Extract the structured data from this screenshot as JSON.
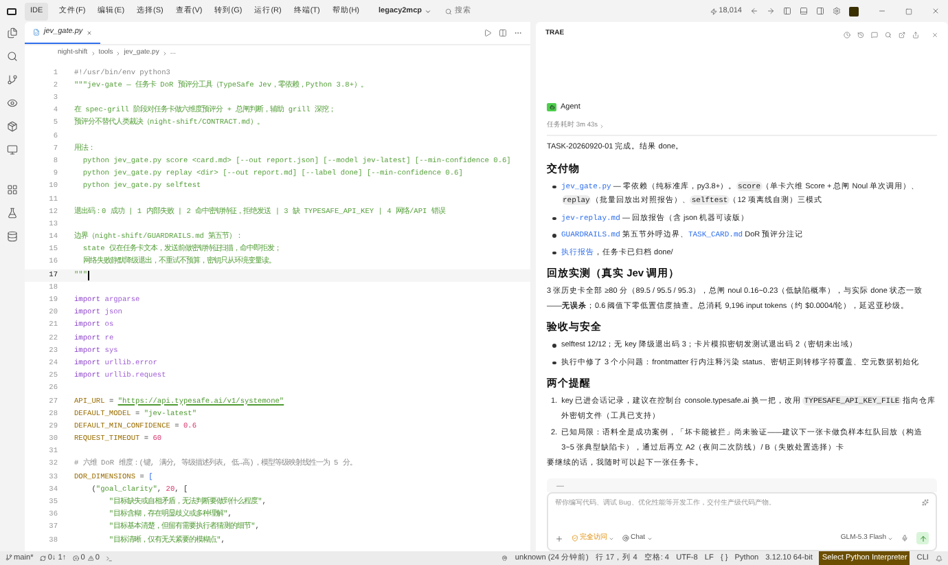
{
  "menubar": {
    "app_tab": "IDE",
    "menus": [
      "文件(F)",
      "编辑(E)",
      "选择(S)",
      "查看(V)",
      "转到(G)",
      "运行(R)",
      "终端(T)",
      "帮助(H)"
    ],
    "project": "legacy2mcp",
    "search_placeholder": "搜索",
    "counter": "18,014"
  },
  "editor": {
    "tab": {
      "label": "jev_gate.py",
      "selected": true
    },
    "breadcrumb": [
      "night-shift",
      "tools",
      "jev_gate.py",
      "..."
    ],
    "lines": [
      {
        "number": "1",
        "current": false,
        "tokens": [
          {
            "kind": "comment",
            "text": "#!/usr/bin/env python3"
          }
        ]
      },
      {
        "number": "2",
        "current": false,
        "tokens": [
          {
            "kind": "doc",
            "text": "\"\"\"jev-gate — 任务卡 DoR 预评分工具（TypeSafe Jev，零依赖，Python 3.8+）。"
          }
        ]
      },
      {
        "number": "3",
        "current": false
      },
      {
        "number": "4",
        "current": false,
        "tokens": [
          {
            "kind": "doc",
            "text": "在 spec-grill 阶段对任务卡做六维度预评分 + 总闸判断，辅助 grill 深挖；"
          }
        ]
      },
      {
        "number": "5",
        "current": false,
        "tokens": [
          {
            "kind": "doc",
            "text": "预评分不替代人类裁决（night-shift/CONTRACT.md）。"
          }
        ]
      },
      {
        "number": "6",
        "current": false
      },
      {
        "number": "7",
        "current": false,
        "tokens": [
          {
            "kind": "doc",
            "text": "用法："
          }
        ]
      },
      {
        "number": "8",
        "current": false,
        "tokens": [
          {
            "kind": "doc",
            "text": "  python jev_gate.py score <card.md> [--out report.json] [--model jev-latest] [--min-confidence 0.6]"
          }
        ]
      },
      {
        "number": "9",
        "current": false,
        "tokens": [
          {
            "kind": "doc",
            "text": "  python jev_gate.py replay <dir> [--out report.md] [--label done] [--min-confidence 0.6]"
          }
        ]
      },
      {
        "number": "10",
        "current": false,
        "tokens": [
          {
            "kind": "doc",
            "text": "  python jev_gate.py selftest"
          }
        ]
      },
      {
        "number": "11",
        "current": false
      },
      {
        "number": "12",
        "current": false,
        "tokens": [
          {
            "kind": "doc",
            "text": "退出码：0 成功 | 1 内部失败 | 2 命中密钥特征，拒绝发送 | 3 缺 TYPESAFE_API_KEY | 4 网络/API 错误"
          }
        ]
      },
      {
        "number": "13",
        "current": false
      },
      {
        "number": "14",
        "current": false,
        "tokens": [
          {
            "kind": "doc",
            "text": "边界（night-shift/GUARDRAILS.md 第五节）："
          }
        ]
      },
      {
        "number": "15",
        "current": false,
        "tokens": [
          {
            "kind": "doc",
            "text": "  state 仅在任务卡文本，发送前做密钥特征扫描，命中即拒发；"
          }
        ]
      },
      {
        "number": "16",
        "current": false,
        "tokens": [
          {
            "kind": "doc",
            "text": "  网络失败静默降级退出，不重试不预算，密钥只从环境变量读。"
          }
        ]
      },
      {
        "number": "17",
        "current": true,
        "tokens": [
          {
            "kind": "doc",
            "text": "\"\"\""
          }
        ]
      },
      {
        "number": "18",
        "current": false
      },
      {
        "number": "19",
        "current": false,
        "tokens": [
          {
            "kind": "keyword",
            "text": "import"
          },
          {
            "kind": "module",
            "text": "argparse"
          }
        ]
      },
      {
        "number": "20",
        "current": false,
        "tokens": [
          {
            "kind": "keyword",
            "text": "import"
          },
          {
            "kind": "module",
            "text": "json"
          }
        ]
      },
      {
        "number": "21",
        "current": false,
        "tokens": [
          {
            "kind": "keyword",
            "text": "import"
          },
          {
            "kind": "module",
            "text": "os"
          }
        ]
      },
      {
        "number": "22",
        "current": false,
        "tokens": [
          {
            "kind": "keyword",
            "text": "import"
          },
          {
            "kind": "module",
            "text": "re"
          }
        ]
      },
      {
        "number": "23",
        "current": false,
        "tokens": [
          {
            "kind": "keyword",
            "text": "import"
          },
          {
            "kind": "module",
            "text": "sys"
          }
        ]
      },
      {
        "number": "24",
        "current": false,
        "tokens": [
          {
            "kind": "keyword",
            "text": "import"
          },
          {
            "kind": "module",
            "text": "urllib.error"
          }
        ]
      },
      {
        "number": "25",
        "current": false,
        "tokens": [
          {
            "kind": "keyword",
            "text": "import"
          },
          {
            "kind": "module",
            "text": "urllib.request"
          }
        ]
      },
      {
        "number": "26",
        "current": false
      },
      {
        "number": "27",
        "current": false,
        "tokens": [
          {
            "kind": "const",
            "text": "API_URL"
          },
          {
            "kind": "plain",
            "text": " = "
          },
          {
            "kind": "url",
            "text": "\"https://api.typesafe.ai/v1/systemone\""
          }
        ]
      },
      {
        "number": "28",
        "current": false,
        "tokens": [
          {
            "kind": "const",
            "text": "DEFAULT_MODEL"
          },
          {
            "kind": "plain",
            "text": " = "
          },
          {
            "kind": "string",
            "text": "\"jev-latest\""
          }
        ]
      },
      {
        "number": "29",
        "current": false,
        "tokens": [
          {
            "kind": "const",
            "text": "DEFAULT_MIN_CONFIDENCE"
          },
          {
            "kind": "plain",
            "text": " = "
          },
          {
            "kind": "number",
            "text": "0.6"
          }
        ]
      },
      {
        "number": "30",
        "current": false,
        "tokens": [
          {
            "kind": "const",
            "text": "REQUEST_TIMEOUT"
          },
          {
            "kind": "plain",
            "text": " = "
          },
          {
            "kind": "number",
            "text": "60"
          }
        ]
      },
      {
        "number": "31",
        "current": false
      },
      {
        "number": "32",
        "current": false,
        "tokens": [
          {
            "kind": "comment",
            "text": "# 六维 DoR 维度：(键, 满分, 等级描述列表, 低→高)，模型等级映射线性一为 5 分。"
          }
        ]
      },
      {
        "number": "33",
        "current": false,
        "tokens": [
          {
            "kind": "const",
            "text": "DOR_DIMENSIONS"
          },
          {
            "kind": "plain",
            "text": " = "
          },
          {
            "kind": "bracket",
            "text": "["
          }
        ]
      },
      {
        "number": "34",
        "current": false,
        "tokens": [
          {
            "kind": "plain",
            "text": "    ("
          },
          {
            "kind": "string",
            "text": "\"goal_clarity\""
          },
          {
            "kind": "plain",
            "text": ", "
          },
          {
            "kind": "number",
            "text": "20"
          },
          {
            "kind": "plain",
            "text": ", ["
          }
        ]
      },
      {
        "number": "35",
        "current": false,
        "tokens": [
          {
            "kind": "string",
            "text": "        \"目标缺失或自相矛盾，无法判断要做到什么程度\""
          },
          {
            "kind": "plain",
            "text": ","
          }
        ]
      },
      {
        "number": "36",
        "current": false,
        "tokens": [
          {
            "kind": "string",
            "text": "        \"目标含糊，存在明显歧义或多种理解\""
          },
          {
            "kind": "plain",
            "text": ","
          }
        ]
      },
      {
        "number": "37",
        "current": false,
        "tokens": [
          {
            "kind": "string",
            "text": "        \"目标基本清楚，但留有需要执行者猜测的细节\""
          },
          {
            "kind": "plain",
            "text": ","
          }
        ]
      },
      {
        "number": "38",
        "current": false,
        "tokens": [
          {
            "kind": "string",
            "text": "        \"目标清晰，仅有无关紧要的模糊点\""
          },
          {
            "kind": "plain",
            "text": ","
          }
        ]
      }
    ]
  },
  "chat": {
    "title": "TRAE",
    "agent": "Agent",
    "elapsed": "任务耗时 3m 43s",
    "blocks": [
      {
        "kind": "paragraph",
        "segments": [
          {
            "kind": "text",
            "text": "TASK-20260920-01 完成。结果 done。"
          }
        ]
      },
      {
        "kind": "heading",
        "text": "交付物"
      },
      {
        "kind": "bullets",
        "items": [
          [
            {
              "kind": "filelink",
              "text": "jev_gate.py"
            },
            {
              "kind": "text",
              "text": " — 零依赖（纯标准库，py3.8+）。"
            },
            {
              "kind": "code",
              "text": "score"
            },
            {
              "kind": "text",
              "text": "（单卡六维 Score + 总闸 Noul 单次调用）、"
            },
            {
              "kind": "code",
              "text": "replay"
            },
            {
              "kind": "text",
              "text": "（批量回放出对照报告）、"
            },
            {
              "kind": "code",
              "text": "selftest"
            },
            {
              "kind": "text",
              "text": "（12 项离线自测）三模式"
            }
          ],
          [
            {
              "kind": "filelink",
              "text": "jev-replay.md"
            },
            {
              "kind": "text",
              "text": " — 回放报告（含 json 机器可读版）"
            }
          ],
          [
            {
              "kind": "filelink",
              "text": "GUARDRAILS.md"
            },
            {
              "kind": "text",
              "text": " 第五节外呼边界、"
            },
            {
              "kind": "filelink",
              "text": "TASK_CARD.md"
            },
            {
              "kind": "text",
              "text": " DoR 预评分注记"
            }
          ],
          [
            {
              "kind": "link",
              "text": "执行报告"
            },
            {
              "kind": "text",
              "text": "，任务卡已归档 done/"
            }
          ]
        ]
      },
      {
        "kind": "heading",
        "text": "回放实测（真实 Jev 调用）"
      },
      {
        "kind": "paragraph",
        "segments": [
          {
            "kind": "text",
            "text": "3 张历史卡全部 ≥80 分（89.5 / 95.5 / 95.3），总闸 noul 0.16~0.23（低缺陷概率），与实际 done 状态一致——"
          },
          {
            "kind": "bold",
            "text": "无误杀"
          },
          {
            "kind": "text",
            "text": "；0.6 阈值下零低置信度抽查。总消耗 9,196 input tokens（约 $0.0004/轮），延迟亚秒级。"
          }
        ]
      },
      {
        "kind": "heading",
        "text": "验收与安全"
      },
      {
        "kind": "bullets",
        "items": [
          [
            {
              "kind": "text",
              "text": "selftest 12/12；无 key 降级退出码 3；卡片模拟密钥发测试退出码 2（密钥未出域）"
            }
          ],
          [
            {
              "kind": "text",
              "text": "执行中修了 3 个小问题：frontmatter 行内注释污染 status、密钥正则转移字符覆盖、空元数据初始化"
            }
          ]
        ]
      },
      {
        "kind": "heading",
        "text": "两个提醒"
      },
      {
        "kind": "numbered",
        "items": [
          {
            "marker": "1.",
            "segments": [
              {
                "kind": "text",
                "text": "key 已进会话记录，建议在控制台 console.typesafe.ai 换一把，改用 "
              },
              {
                "kind": "code",
                "text": "TYPESAFE_API_KEY_FILE"
              },
              {
                "kind": "text",
                "text": " 指向仓库外密钥文件（工具已支持）"
              }
            ]
          },
          {
            "marker": "2.",
            "segments": [
              {
                "kind": "text",
                "text": "已知局限：语料全是成功案例，「坏卡能被拦」尚未验证——建议下一张卡做负样本红队回放（构造 3~5 张典型缺陷卡），通过后再立 A2（夜间二次防线）/ B（失败处置选择）卡"
              }
            ]
          }
        ]
      },
      {
        "kind": "paragraph",
        "segments": [
          {
            "kind": "text",
            "text": "要继续的话，我随时可以起下一张任务卡。"
          }
        ]
      }
    ],
    "collapsed": "—",
    "composer": {
      "placeholder": "帮你编写代码、调试 Bug、优化性能等开发工作，交付生产级代码产物。",
      "mode": "完全访问",
      "chat_mode": "Chat",
      "model": "GLM-5.3 Flash"
    }
  },
  "status_bar": {
    "branch": "main*",
    "sync": "0↓ 1↑",
    "errors": "0",
    "warnings": "0",
    "items": [
      {
        "text": "unknown (24 分钟前)",
        "highlighted": false
      },
      {
        "text": "行 17，列 4",
        "highlighted": false
      },
      {
        "text": "空格: 4",
        "highlighted": false
      },
      {
        "text": "UTF-8",
        "highlighted": false
      },
      {
        "text": "LF",
        "highlighted": false
      },
      {
        "text": "{ }",
        "highlighted": false
      },
      {
        "text": "Python",
        "highlighted": false
      },
      {
        "text": "3.12.10 64-bit",
        "highlighted": false
      },
      {
        "text": "Select Python Interpreter",
        "highlighted": true
      },
      {
        "text": "CLI",
        "highlighted": false
      }
    ]
  }
}
